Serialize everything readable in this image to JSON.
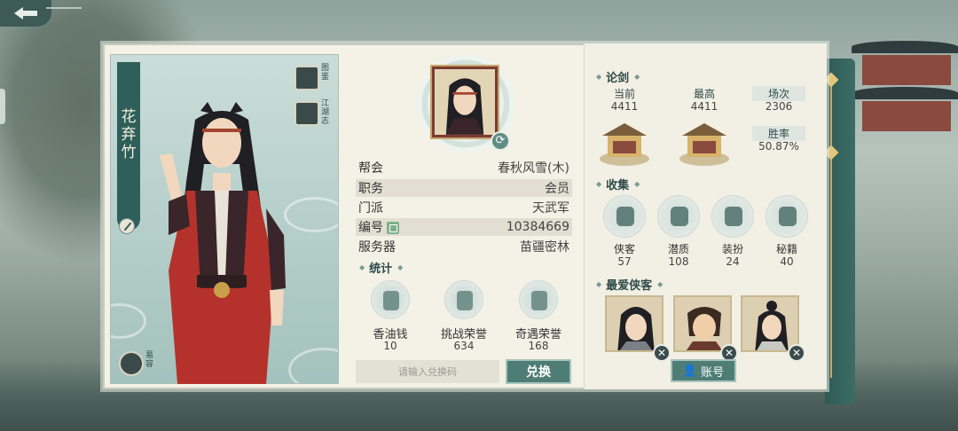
{
  "back": {
    "icon": "back-arrow-icon"
  },
  "character": {
    "name_chars": [
      "花",
      "弃",
      "竹"
    ],
    "tools": [
      {
        "icon": "illustrated-guide-icon",
        "label": "图鉴"
      },
      {
        "icon": "jianghu-chronicle-icon",
        "label": "江湖志"
      },
      {
        "icon": "appearance-mask-icon",
        "label": "易容"
      }
    ]
  },
  "info": {
    "rows": [
      {
        "label": "帮会",
        "value": "春秋风雪(木)"
      },
      {
        "label": "职务",
        "value": "会员"
      },
      {
        "label": "门派",
        "value": "天武军"
      },
      {
        "label": "编号",
        "value": "10384669"
      },
      {
        "label": "服务器",
        "value": "苗疆密林"
      }
    ]
  },
  "stats": {
    "title": "统计",
    "items": [
      {
        "label": "香油钱",
        "value": "10",
        "icon": "incense-money-icon"
      },
      {
        "label": "挑战荣誉",
        "value": "634",
        "icon": "challenge-honor-icon"
      },
      {
        "label": "奇遇荣誉",
        "value": "168",
        "icon": "encounter-honor-icon"
      }
    ]
  },
  "redeem": {
    "placeholder": "请输入兑换码",
    "button": "兑换"
  },
  "lunjian": {
    "title": "论剑",
    "current_label": "当前",
    "current_value": "4411",
    "highest_label": "最高",
    "highest_value": "4411",
    "matches_label": "场次",
    "matches_value": "2306",
    "winrate_label": "胜率",
    "winrate_value": "50.87%"
  },
  "collection": {
    "title": "收集",
    "items": [
      {
        "label": "侠客",
        "value": "57",
        "icon": "hero-icon"
      },
      {
        "label": "潜质",
        "value": "108",
        "icon": "dragon-potential-icon"
      },
      {
        "label": "装扮",
        "value": "24",
        "icon": "costume-icon"
      },
      {
        "label": "秘籍",
        "value": "40",
        "icon": "manual-book-icon"
      }
    ]
  },
  "favorites": {
    "title": "最爱侠客",
    "account_button": "账号"
  },
  "colors": {
    "accent": "#4e7d76",
    "dark": "#2f5f5a",
    "panel": "#f4f1e6"
  }
}
